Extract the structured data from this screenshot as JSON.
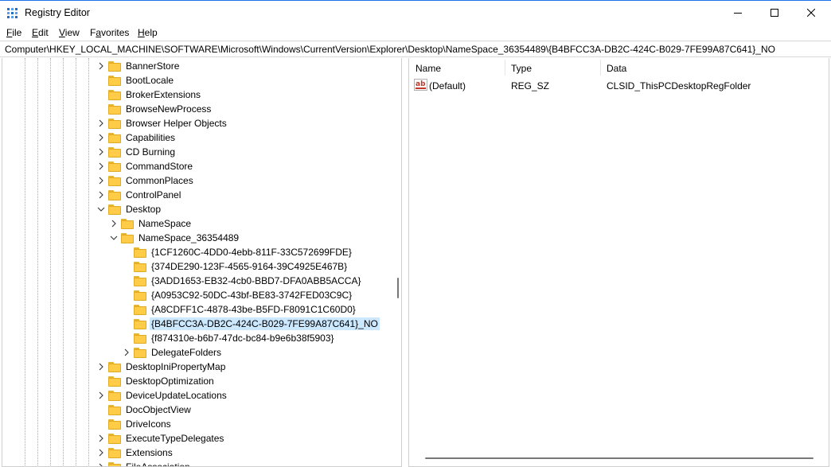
{
  "window": {
    "title": "Registry Editor"
  },
  "menu": [
    {
      "label": "File",
      "accel": "F",
      "rest": "ile"
    },
    {
      "label": "Edit",
      "accel": "E",
      "rest": "dit"
    },
    {
      "label": "View",
      "accel": "V",
      "rest": "iew"
    },
    {
      "label": "Favorites",
      "accel": "a",
      "pre": "F",
      "rest": "vorites"
    },
    {
      "label": "Help",
      "accel": "H",
      "rest": "elp"
    }
  ],
  "address": "Computer\\HKEY_LOCAL_MACHINE\\SOFTWARE\\Microsoft\\Windows\\CurrentVersion\\Explorer\\Desktop\\NameSpace_36354489\\{B4BFCC3A-DB2C-424C-B029-7FE99A87C641}_NO",
  "tree": [
    {
      "label": "BannerStore",
      "level": 0,
      "expander": "collapsed"
    },
    {
      "label": "BootLocale",
      "level": 0,
      "expander": "none"
    },
    {
      "label": "BrokerExtensions",
      "level": 0,
      "expander": "none"
    },
    {
      "label": "BrowseNewProcess",
      "level": 0,
      "expander": "none"
    },
    {
      "label": "Browser Helper Objects",
      "level": 0,
      "expander": "collapsed"
    },
    {
      "label": "Capabilities",
      "level": 0,
      "expander": "collapsed"
    },
    {
      "label": "CD Burning",
      "level": 0,
      "expander": "collapsed"
    },
    {
      "label": "CommandStore",
      "level": 0,
      "expander": "collapsed"
    },
    {
      "label": "CommonPlaces",
      "level": 0,
      "expander": "collapsed"
    },
    {
      "label": "ControlPanel",
      "level": 0,
      "expander": "collapsed"
    },
    {
      "label": "Desktop",
      "level": 0,
      "expander": "expanded"
    },
    {
      "label": "NameSpace",
      "level": 1,
      "expander": "collapsed"
    },
    {
      "label": "NameSpace_36354489",
      "level": 1,
      "expander": "expanded"
    },
    {
      "label": "{1CF1260C-4DD0-4ebb-811F-33C572699FDE}",
      "level": 2,
      "expander": "none"
    },
    {
      "label": "{374DE290-123F-4565-9164-39C4925E467B}",
      "level": 2,
      "expander": "none"
    },
    {
      "label": "{3ADD1653-EB32-4cb0-BBD7-DFA0ABB5ACCA}",
      "level": 2,
      "expander": "none"
    },
    {
      "label": "{A0953C92-50DC-43bf-BE83-3742FED03C9C}",
      "level": 2,
      "expander": "none"
    },
    {
      "label": "{A8CDFF1C-4878-43be-B5FD-F8091C1C60D0}",
      "level": 2,
      "expander": "none"
    },
    {
      "label": "{B4BFCC3A-DB2C-424C-B029-7FE99A87C641}_NO",
      "level": 2,
      "expander": "none",
      "selected": true
    },
    {
      "label": "{f874310e-b6b7-47dc-bc84-b9e6b38f5903}",
      "level": 2,
      "expander": "none"
    },
    {
      "label": "DelegateFolders",
      "level": 2,
      "expander": "collapsed"
    },
    {
      "label": "DesktopIniPropertyMap",
      "level": 0,
      "expander": "collapsed"
    },
    {
      "label": "DesktopOptimization",
      "level": 0,
      "expander": "none"
    },
    {
      "label": "DeviceUpdateLocations",
      "level": 0,
      "expander": "collapsed"
    },
    {
      "label": "DocObjectView",
      "level": 0,
      "expander": "none"
    },
    {
      "label": "DriveIcons",
      "level": 0,
      "expander": "none"
    },
    {
      "label": "ExecuteTypeDelegates",
      "level": 0,
      "expander": "collapsed"
    },
    {
      "label": "Extensions",
      "level": 0,
      "expander": "collapsed"
    },
    {
      "label": "FileAssociation",
      "level": 0,
      "expander": "collapsed"
    }
  ],
  "list": {
    "columns": {
      "name": "Name",
      "type": "Type",
      "data": "Data"
    },
    "rows": [
      {
        "name": "(Default)",
        "type": "REG_SZ",
        "data": "CLSID_ThisPCDesktopRegFolder",
        "icon": "string-value-icon"
      }
    ]
  },
  "colors": {
    "selection": "#cce8ff",
    "folder": "#ffcc48",
    "accent": "#1a73e8"
  }
}
